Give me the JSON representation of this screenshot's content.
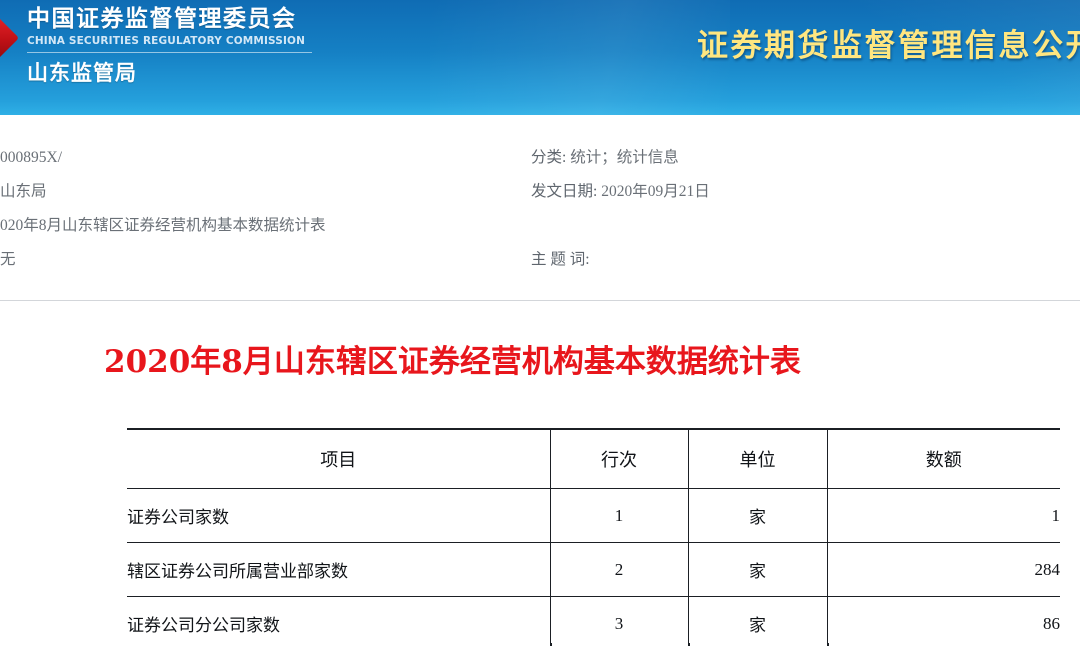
{
  "banner": {
    "org_cn": "中国证券监督管理委员会",
    "org_en": "CHINA SECURITIES REGULATORY COMMISSION",
    "bureau": "山东监管局",
    "title": "证券期货监督管理信息公开",
    "emblem_icon": "csrc-diamond-emblem-icon",
    "gradient_top_color": "#0f6cb4",
    "gradient_bottom_color": "#2fb0e6",
    "title_color": "#ffe680"
  },
  "meta": {
    "left": [
      {
        "value": "000895X/"
      },
      {
        "value": "山东局"
      },
      {
        "value": "020年8月山东辖区证券经营机构基本数据统计表"
      },
      {
        "value": "无"
      }
    ],
    "right": [
      {
        "label": "分类:",
        "value": "统计；统计信息"
      },
      {
        "label": "发文日期:",
        "value": "2020年09月21日"
      },
      {
        "label": "",
        "value": ""
      },
      {
        "label": "主 题 词:",
        "value": ""
      }
    ]
  },
  "document": {
    "title": "2020年8月山东辖区证券经营机构基本数据统计表",
    "title_color": "#e8161c"
  },
  "table": {
    "headers": [
      "项目",
      "行次",
      "单位",
      "数额"
    ],
    "rows": [
      {
        "item": "证券公司家数",
        "line": "1",
        "unit": "家",
        "amount": "1"
      },
      {
        "item": "辖区证券公司所属营业部家数",
        "line": "2",
        "unit": "家",
        "amount": "284"
      },
      {
        "item": "证券公司分公司家数",
        "line": "3",
        "unit": "家",
        "amount": "86"
      }
    ]
  }
}
